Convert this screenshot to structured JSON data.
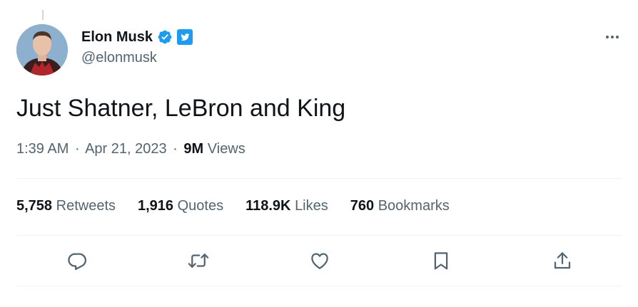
{
  "author": {
    "display_name": "Elon Musk",
    "handle": "@elonmusk",
    "verified": true
  },
  "tweet": {
    "text": "Just Shatner, LeBron and King"
  },
  "meta": {
    "time": "1:39 AM",
    "date": "Apr 21, 2023",
    "separator": "·",
    "views_count": "9M",
    "views_label": "Views"
  },
  "stats": [
    {
      "count": "5,758",
      "label": "Retweets"
    },
    {
      "count": "1,916",
      "label": "Quotes"
    },
    {
      "count": "118.9K",
      "label": "Likes"
    },
    {
      "count": "760",
      "label": "Bookmarks"
    }
  ],
  "icons": {
    "reply": "reply-icon",
    "retweet": "retweet-icon",
    "like": "heart-icon",
    "bookmark": "bookmark-icon",
    "share": "share-icon",
    "more": "more-icon",
    "verified": "verified-badge-icon",
    "affiliate": "twitter-badge-icon"
  },
  "colors": {
    "text_primary": "#0f1419",
    "text_secondary": "#536471",
    "verified_blue": "#1d9bf0",
    "divider": "#eff3f4"
  }
}
